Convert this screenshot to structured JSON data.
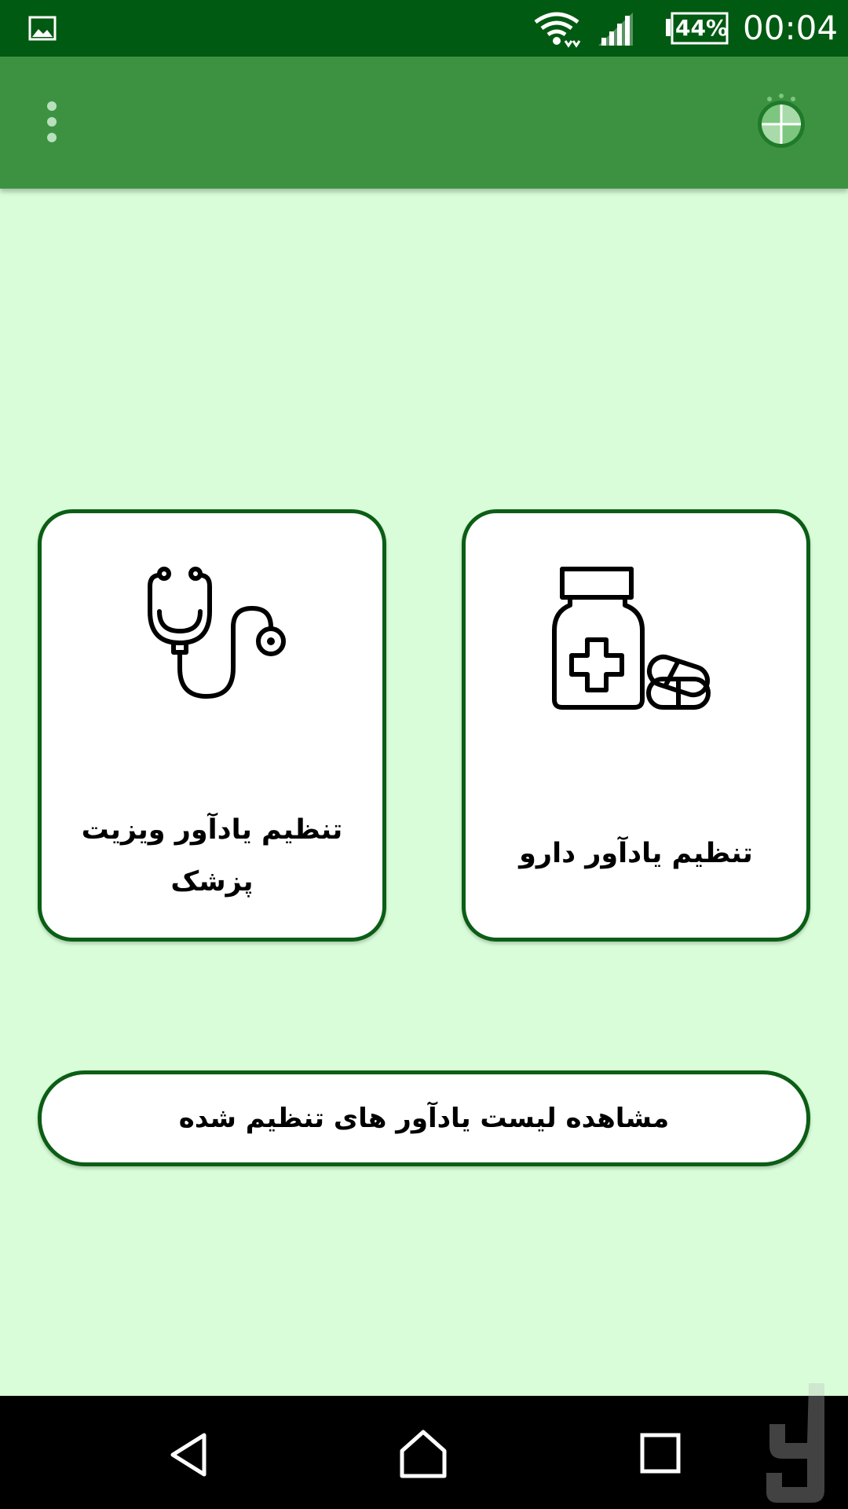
{
  "status_bar": {
    "battery": "44%",
    "time": "00:04",
    "icons": [
      "gallery-icon",
      "wifi-icon",
      "signal-icon",
      "battery-icon"
    ]
  },
  "app_bar": {
    "icons": [
      "overflow-menu-icon",
      "app-logo-icon"
    ]
  },
  "cards": {
    "drug": {
      "label": "تنظیم یادآور دارو",
      "icon": "medicine-bottle-icon"
    },
    "doctor": {
      "label": "تنظیم یادآور ویزیت پزشک",
      "icon": "stethoscope-icon"
    }
  },
  "list_button": {
    "label": "مشاهده لیست یادآور های تنظیم شده"
  },
  "nav_bar": {
    "icons": [
      "back-icon",
      "home-icon",
      "recents-icon"
    ]
  },
  "colors": {
    "status_bar": "#015a11",
    "app_bar": "#3d9242",
    "background": "#d9fdd9",
    "card_border": "#0b5e15"
  }
}
